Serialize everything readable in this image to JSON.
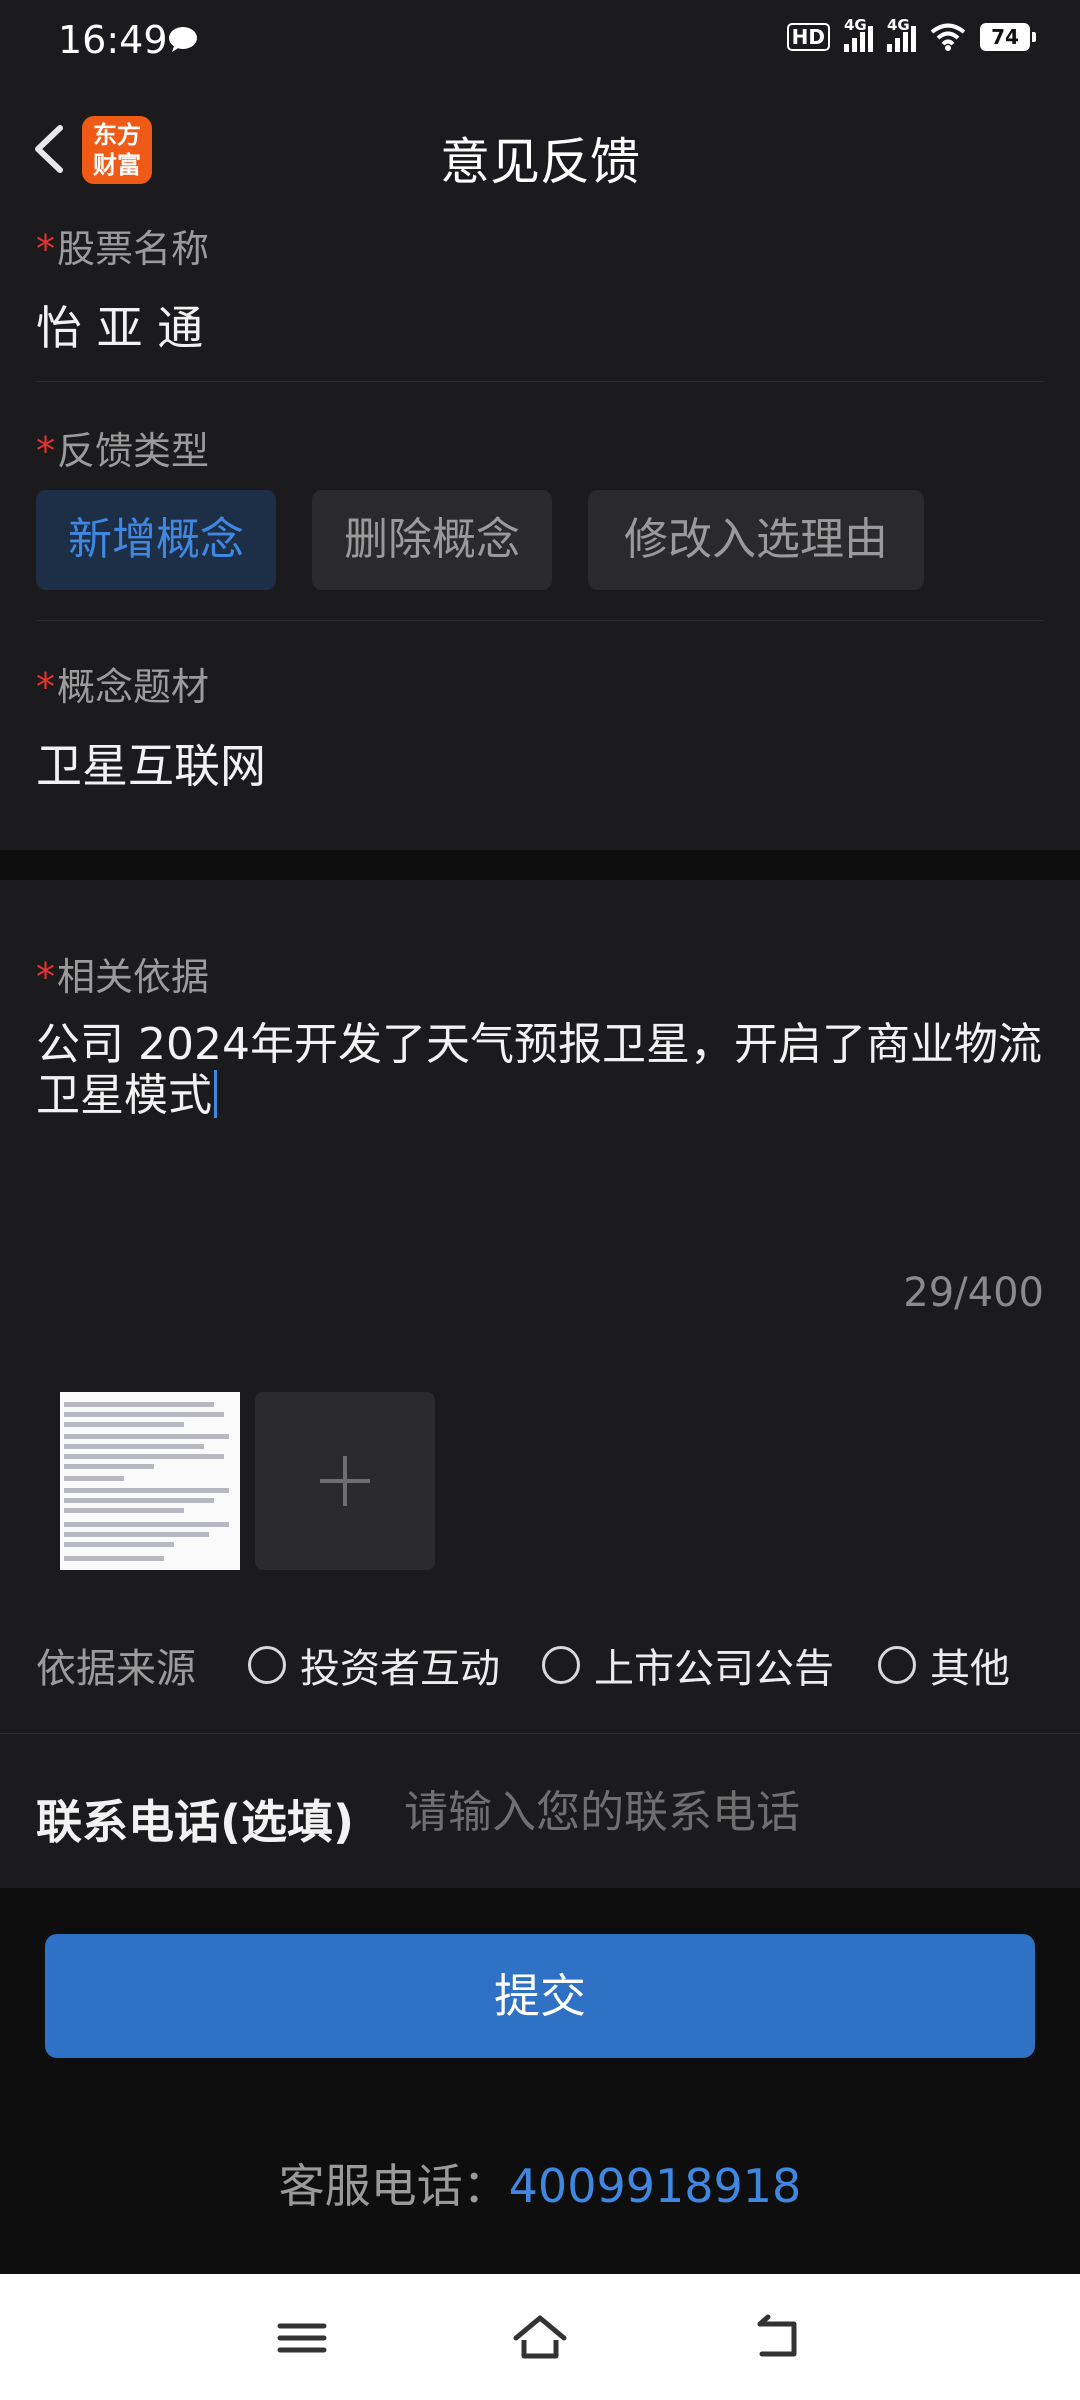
{
  "status_bar": {
    "time": "16:49",
    "hd": "HD",
    "network1": "4G",
    "network2": "4G",
    "battery": "74"
  },
  "header": {
    "title": "意见反馈",
    "logo_line1": "东方",
    "logo_line2": "财富"
  },
  "form": {
    "stock_label": "股票名称",
    "stock_value": "怡 亚 通",
    "type_label": "反馈类型",
    "type_options": [
      "新增概念",
      "删除概念",
      "修改入选理由"
    ],
    "type_selected": "新增概念",
    "concept_label": "概念题材",
    "concept_value": "卫星互联网",
    "basis_label": "相关依据",
    "basis_text": "公司 2024年开发了天气预报卫星，开启了商业物流卫星模式",
    "counter": "29/400",
    "source_label": "依据来源",
    "source_options": [
      "投资者互动",
      "上市公司公告",
      "其他"
    ],
    "phone_label": "联系电话(选填)",
    "phone_placeholder": "请输入您的联系电话",
    "phone_value": ""
  },
  "submit_label": "提交",
  "service": {
    "label": "客服电话：",
    "number": "4009918918"
  }
}
